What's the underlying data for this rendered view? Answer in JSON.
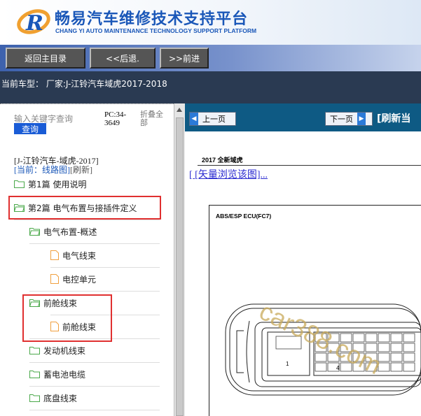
{
  "header": {
    "title": "畅易汽车维修技术支持平台",
    "subtitle": "CHANG YI AUTO MAINTENANCE TECHNOLOGY SUPPORT PLATFORM",
    "logo_letter": "R"
  },
  "nav": {
    "back_label": "返回主目录",
    "prev_label": "<<后退.",
    "next_label": ">>前进"
  },
  "infobar": {
    "current_vehicle": "当前车型： 厂家:J-江铃汽车域虎2017-2018"
  },
  "sidebar": {
    "search_placeholder": "输入关键字查询",
    "search_button": "查询",
    "pc_label": "PC:34-3649",
    "fold_label": "折叠全部",
    "vehicle": "[J-江铃汽车-域虎-2017]",
    "current_prefix": "[当前：线路图]",
    "refresh": "[刷新]",
    "tree": [
      {
        "label": "第1篇 使用说明",
        "icon": "folder-icon"
      },
      {
        "label": "第2篇 电气布置与接插件定义",
        "icon": "folder-icon"
      },
      {
        "label": "电气布置-概述",
        "icon": "folder-icon"
      },
      {
        "label": "电气线束",
        "icon": "document-icon"
      },
      {
        "label": "电控单元",
        "icon": "document-icon"
      },
      {
        "label": "前舱线束",
        "icon": "folder-icon"
      },
      {
        "label": "前舱线束",
        "icon": "document-icon"
      },
      {
        "label": "发动机线束",
        "icon": "folder-icon"
      },
      {
        "label": "蓄电池电缆",
        "icon": "folder-icon"
      },
      {
        "label": "底盘线束",
        "icon": "folder-icon"
      }
    ]
  },
  "content": {
    "prev_page": "上一页",
    "next_page": "下一页",
    "refresh_link": "[刷新当",
    "doc_title": "2017 全新域虎",
    "vector_link": "[ [矢量浏览该图]...",
    "diagram_label": "ABS/ESP ECU(FC7)",
    "pin_labels": [
      "1",
      "4"
    ],
    "watermark": "car388.com"
  },
  "colors": {
    "brand_blue": "#1a57b8",
    "info_bar": "#2a3a52",
    "toolbar": "#0e5a84",
    "highlight_red": "#e03030",
    "folder_green": "#4aa84a",
    "doc_orange": "#f0a040"
  }
}
